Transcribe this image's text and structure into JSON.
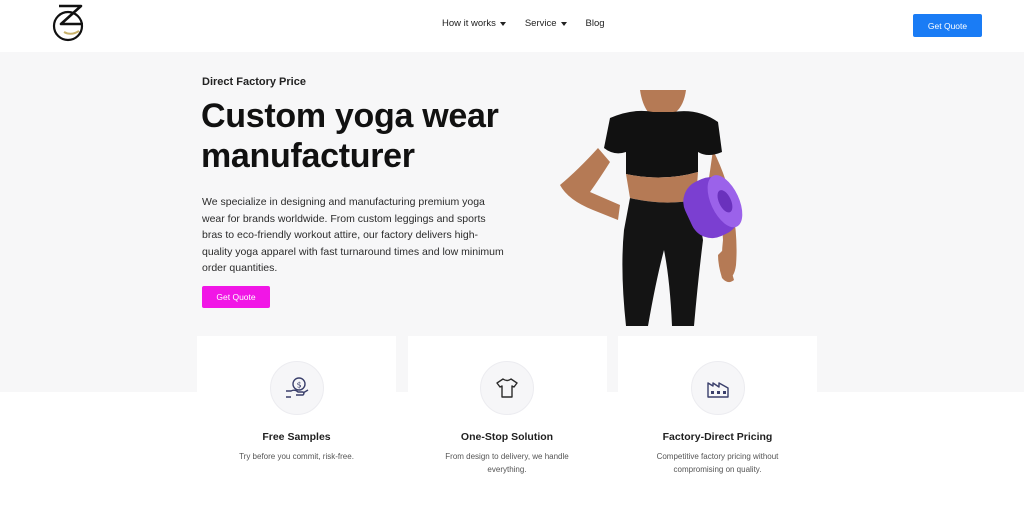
{
  "header": {
    "nav": [
      {
        "label": "How it works",
        "dropdown": true
      },
      {
        "label": "Service",
        "dropdown": true
      },
      {
        "label": "Blog",
        "dropdown": false
      }
    ],
    "cta_label": "Get Quote",
    "cta_color": "#1a7cf5"
  },
  "hero": {
    "eyebrow": "Direct Factory Price",
    "headline_line1": "Custom yoga wear",
    "headline_line2": "manufacturer",
    "description": "We specialize in designing and manufacturing premium yoga wear for brands worldwide. From custom leggings and sports bras to eco-friendly workout attire, our factory delivers high-quality yoga apparel with fast turnaround times and low minimum order quantities.",
    "cta_label": "Get Quote",
    "cta_color": "#f116e6"
  },
  "features": [
    {
      "icon": "hand-coin-icon",
      "title": "Free Samples",
      "text": "Try before you commit, risk-free."
    },
    {
      "icon": "tshirt-icon",
      "title": "One-Stop Solution",
      "text": "From design to delivery, we handle everything."
    },
    {
      "icon": "factory-icon",
      "title": "Factory-Direct Pricing",
      "text": "Competitive factory pricing without compromising on quality."
    }
  ]
}
